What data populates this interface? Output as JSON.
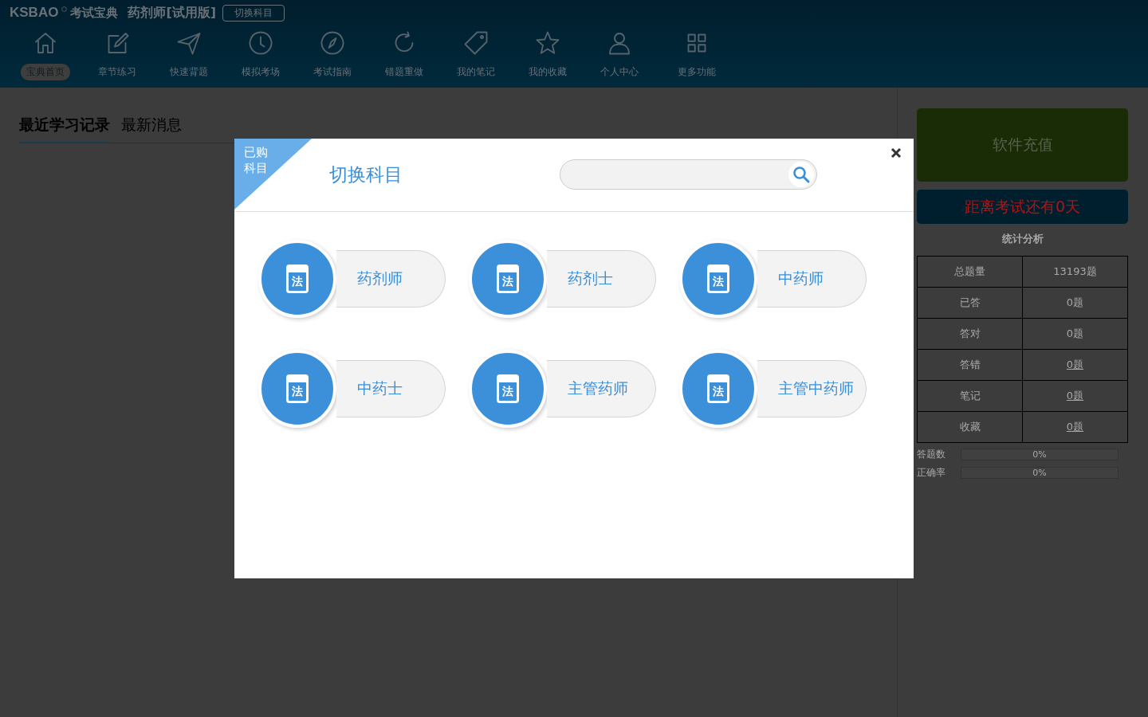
{
  "header": {
    "logo": "KSBAO",
    "logo_sub": "考试宝典",
    "product": "药剂师[试用版]",
    "switch_button": "切换科目"
  },
  "nav": [
    {
      "label": "宝典首页",
      "selected": true
    },
    {
      "label": "章节练习",
      "selected": false
    },
    {
      "label": "快速背题",
      "selected": false
    },
    {
      "label": "模拟考场",
      "selected": false
    },
    {
      "label": "考试指南",
      "selected": false
    },
    {
      "label": "错题重做",
      "selected": false
    },
    {
      "label": "我的笔记",
      "selected": false
    },
    {
      "label": "我的收藏",
      "selected": false
    },
    {
      "label": "个人中心",
      "selected": false
    },
    {
      "label": "更多功能",
      "selected": false
    }
  ],
  "tabs": [
    {
      "label": "最近学习记录",
      "selected": true
    },
    {
      "label": "最新消息",
      "selected": false
    }
  ],
  "sidebar": {
    "recharge_button": "软件充值",
    "countdown": "距离考试还有0天",
    "stats_title": "统计分析",
    "stats": [
      {
        "label": "总题量",
        "value": "13193题",
        "link": false
      },
      {
        "label": "已答",
        "value": "0题",
        "link": false
      },
      {
        "label": "答对",
        "value": "0题",
        "link": false
      },
      {
        "label": "答错",
        "value": "0题",
        "link": true
      },
      {
        "label": "笔记",
        "value": "0题",
        "link": true
      },
      {
        "label": "收藏",
        "value": "0题",
        "link": true
      }
    ],
    "progress": [
      {
        "label": "答题数",
        "reading": "0%",
        "level": 0
      },
      {
        "label": "正确率",
        "reading": "0%",
        "level": 0
      }
    ]
  },
  "dialog": {
    "corner_tag": "已购科目",
    "title": "切换科目",
    "subjects": [
      {
        "name": "药剂师",
        "badge": "法"
      },
      {
        "name": "药剂士",
        "badge": "法"
      },
      {
        "name": "中药师",
        "badge": "法"
      },
      {
        "name": "中药士",
        "badge": "法"
      },
      {
        "name": "主管药师",
        "badge": "法"
      },
      {
        "name": "主管中药师",
        "badge": "法"
      }
    ]
  }
}
